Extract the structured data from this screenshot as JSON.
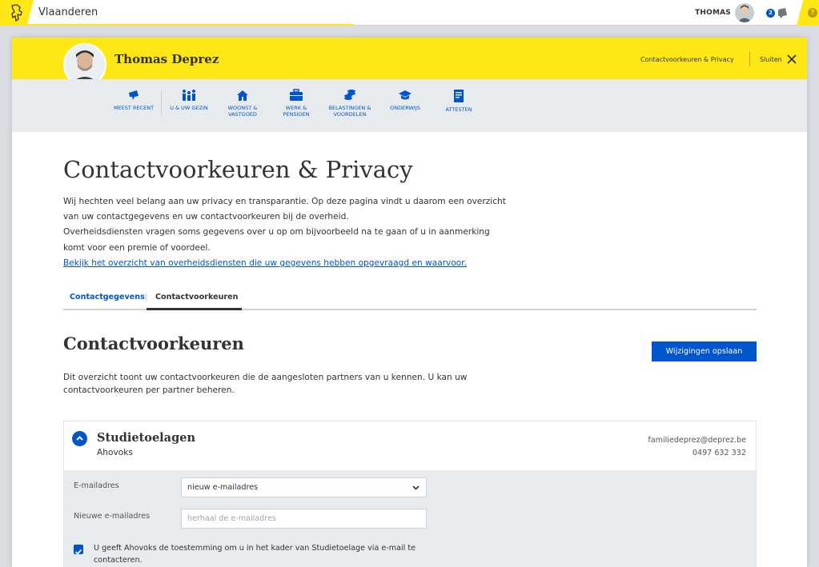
{
  "global_header": {
    "title": "Vlaanderen",
    "user": "THOMAS",
    "notifications": "2"
  },
  "profile": {
    "name": "Thomas Deprez",
    "link": "Contactvoorkeuren & Privacy",
    "close": "Sluiten"
  },
  "nav": [
    {
      "label": "MEEST RECENT",
      "icon": "pin-icon"
    },
    {
      "label": "U & UW GEZIN",
      "icon": "family-icon"
    },
    {
      "label": "WOONST & VASTGOED",
      "icon": "house-icon"
    },
    {
      "label": "WERK & PENSIOEN",
      "icon": "briefcase-icon"
    },
    {
      "label": "BELASTINGEN & VOORDELEN",
      "icon": "coins-icon"
    },
    {
      "label": "ONDERWIJS",
      "icon": "graduation-cap-icon"
    },
    {
      "label": "ATTESTEN",
      "icon": "document-icon"
    }
  ],
  "page": {
    "title": "Contactvoorkeuren & Privacy",
    "intro_lines": [
      "Wij hechten veel belang aan uw privacy en transparantie. Op deze pagina vindt u daarom een overzicht",
      "van uw contactgegevens en uw contactvoorkeuren bij de overheid.",
      "Overheidsdiensten vragen soms gegevens over u op om bijvoorbeeld na te gaan of u in aanmerking",
      "komt voor een premie of voordeel."
    ],
    "intro_link": "Bekijk het overzicht van overheidsdiensten die uw gegevens hebben opgevraagd en waarvoor."
  },
  "tabs": {
    "tab1": "Contactgegevens",
    "tab2": "Contactvoorkeuren"
  },
  "section": {
    "title": "Contactvoorkeuren",
    "save_label": "Wijzigingen opslaan",
    "desc": "Dit overzicht toont uw contactvoorkeuren die de aangesloten partners van u kennen. U kan uw contactvoorkeuren per partner beheren."
  },
  "partner": {
    "name": "Studietoelagen",
    "org": "Ahovoks",
    "email": "familiedeprez@deprez.be",
    "phone": "0497 632 332",
    "email_label": "E-mailadres",
    "email_select": "nieuw e-mailadres",
    "new_email_label": "Nieuwe e-mailadres",
    "new_email_placeholder": "herhaal de e-mailadres",
    "consent": "U geeft Ahovoks de toestemming om u in het kader van Studietoelage via e-mail te contacteren.",
    "consent_checked": true
  },
  "colors": {
    "brand_yellow": "#ffe615",
    "accent_blue": "#0055cc"
  }
}
